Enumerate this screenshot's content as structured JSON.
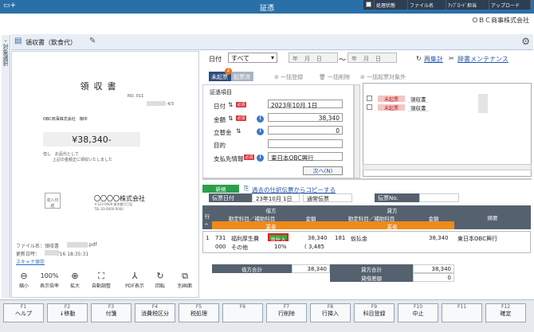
{
  "window": {
    "title": "証憑",
    "icons": "▭+",
    "min": "—",
    "max": "▢",
    "close": "✕"
  },
  "company": "ＯＢＣ商事株式会社",
  "sidebar_tab": "対象選択",
  "doc": {
    "title": "領収書（飲食代）"
  },
  "preview": {
    "title": "領収書",
    "no": "NO. 011",
    "date": "4/3",
    "to": "OBC商事株式会社　御中",
    "amount": "¥38,340-",
    "note1": "但し　お品代として",
    "note2": "上記の金額正に領収いたしました",
    "stamp": "収入印紙",
    "issuer": "〇〇〇〇株式会社",
    "addr1": "〒123-0000 東京都〇〇区",
    "addr2": "TEL 03-0000-0000"
  },
  "file_info": {
    "filename_label": "ファイル名：領収書",
    "filename_ext": ".pdf",
    "updated": "更新日時：　　　09/16 18:35:31",
    "scanner": "スキャナ保存"
  },
  "tools": [
    {
      "icon": "⊖",
      "label": "縮小"
    },
    {
      "icon": "100%",
      "label": "表示倍率"
    },
    {
      "icon": "⊕",
      "label": "拡大"
    },
    {
      "icon": "⛶",
      "label": "自動調整"
    },
    {
      "icon": "⅄",
      "label": "PDF表示"
    },
    {
      "icon": "↻",
      "label": "回転"
    },
    {
      "icon": "⧉",
      "label": "別画面"
    }
  ],
  "filter": {
    "label": "日付",
    "select": "すべて",
    "from": "年月日",
    "to": "年月日",
    "tilde": "～",
    "recalc": "再集計",
    "dict": "辞書メンテナンス"
  },
  "status": {
    "unrecorded": "未起票",
    "recorded": "起票済",
    "count": "2",
    "bulk_register": "一括登録",
    "bulk_delete": "一括削除",
    "bulk_exclude": "一括起票対象外"
  },
  "form": {
    "header": "証憑項目",
    "required": "必須",
    "date_label": "日付",
    "date_value": "2023年10月 1日",
    "amount_label": "金額",
    "amount_value": "38,340",
    "tatekae_label": "立替金",
    "tatekae_value": "0",
    "purpose_label": "目的",
    "purpose_value": "",
    "payee_label": "支払先情報",
    "payee_value": "東日本OBC興行",
    "next": "次へ(N)"
  },
  "grid": {
    "headers": [
      "処理状態",
      "ファイル名",
      "ｱｯﾌﾟﾛｰﾄﾞ担当",
      "アップロード"
    ],
    "rows": [
      {
        "status": "未起票",
        "file": "領収書"
      },
      {
        "status": "未起票",
        "file": "領収書"
      }
    ]
  },
  "entry": {
    "new_tab": "新規",
    "copy_link": "過去の仕訳伝票からコピーする",
    "slip_date_label": "伝票日付",
    "slip_date": "23年10月 1日",
    "slip_type": "通常伝票",
    "slip_no_label": "伝票No.",
    "row_label": "行",
    "debit": "借方",
    "credit": "貸方",
    "account_col": "勘定科目／補助科目",
    "amount_col": "金額",
    "summary_col": "摘要",
    "dept": "業者",
    "line": {
      "no": "1",
      "debit_code": "731",
      "debit_name": "福利厚生費",
      "debit_sub_code": "000",
      "debit_sub_name": "その他",
      "tag": "共仕入",
      "debit_amount": "38,340",
      "tax_rate": "10%",
      "tax_amount": "( 3,485",
      "credit_code": "181",
      "credit_name": "仮払金",
      "credit_amount": "38,340",
      "summary": "東日本OBC興行"
    },
    "debit_total_label": "借方合計",
    "debit_total": "38,340",
    "credit_total_label": "貸方合計",
    "credit_total": "38,340",
    "diff_label": "貸借差額",
    "diff": "0"
  },
  "fkeys": [
    {
      "fn": "F1",
      "label": "ヘルプ"
    },
    {
      "fn": "F2",
      "label": "↓移動"
    },
    {
      "fn": "F3",
      "label": "付箋"
    },
    {
      "fn": "F4",
      "label": "消費税区分"
    },
    {
      "fn": "F5",
      "label": "税処理"
    },
    {
      "fn": "F6",
      "label": ""
    },
    {
      "fn": "F7",
      "label": "行削除"
    },
    {
      "fn": "F8",
      "label": "行挿入"
    },
    {
      "fn": "F9",
      "label": "科目登録"
    },
    {
      "fn": "F10",
      "label": "中止"
    },
    {
      "fn": "F11",
      "label": ""
    },
    {
      "fn": "F12",
      "label": "確定"
    }
  ]
}
